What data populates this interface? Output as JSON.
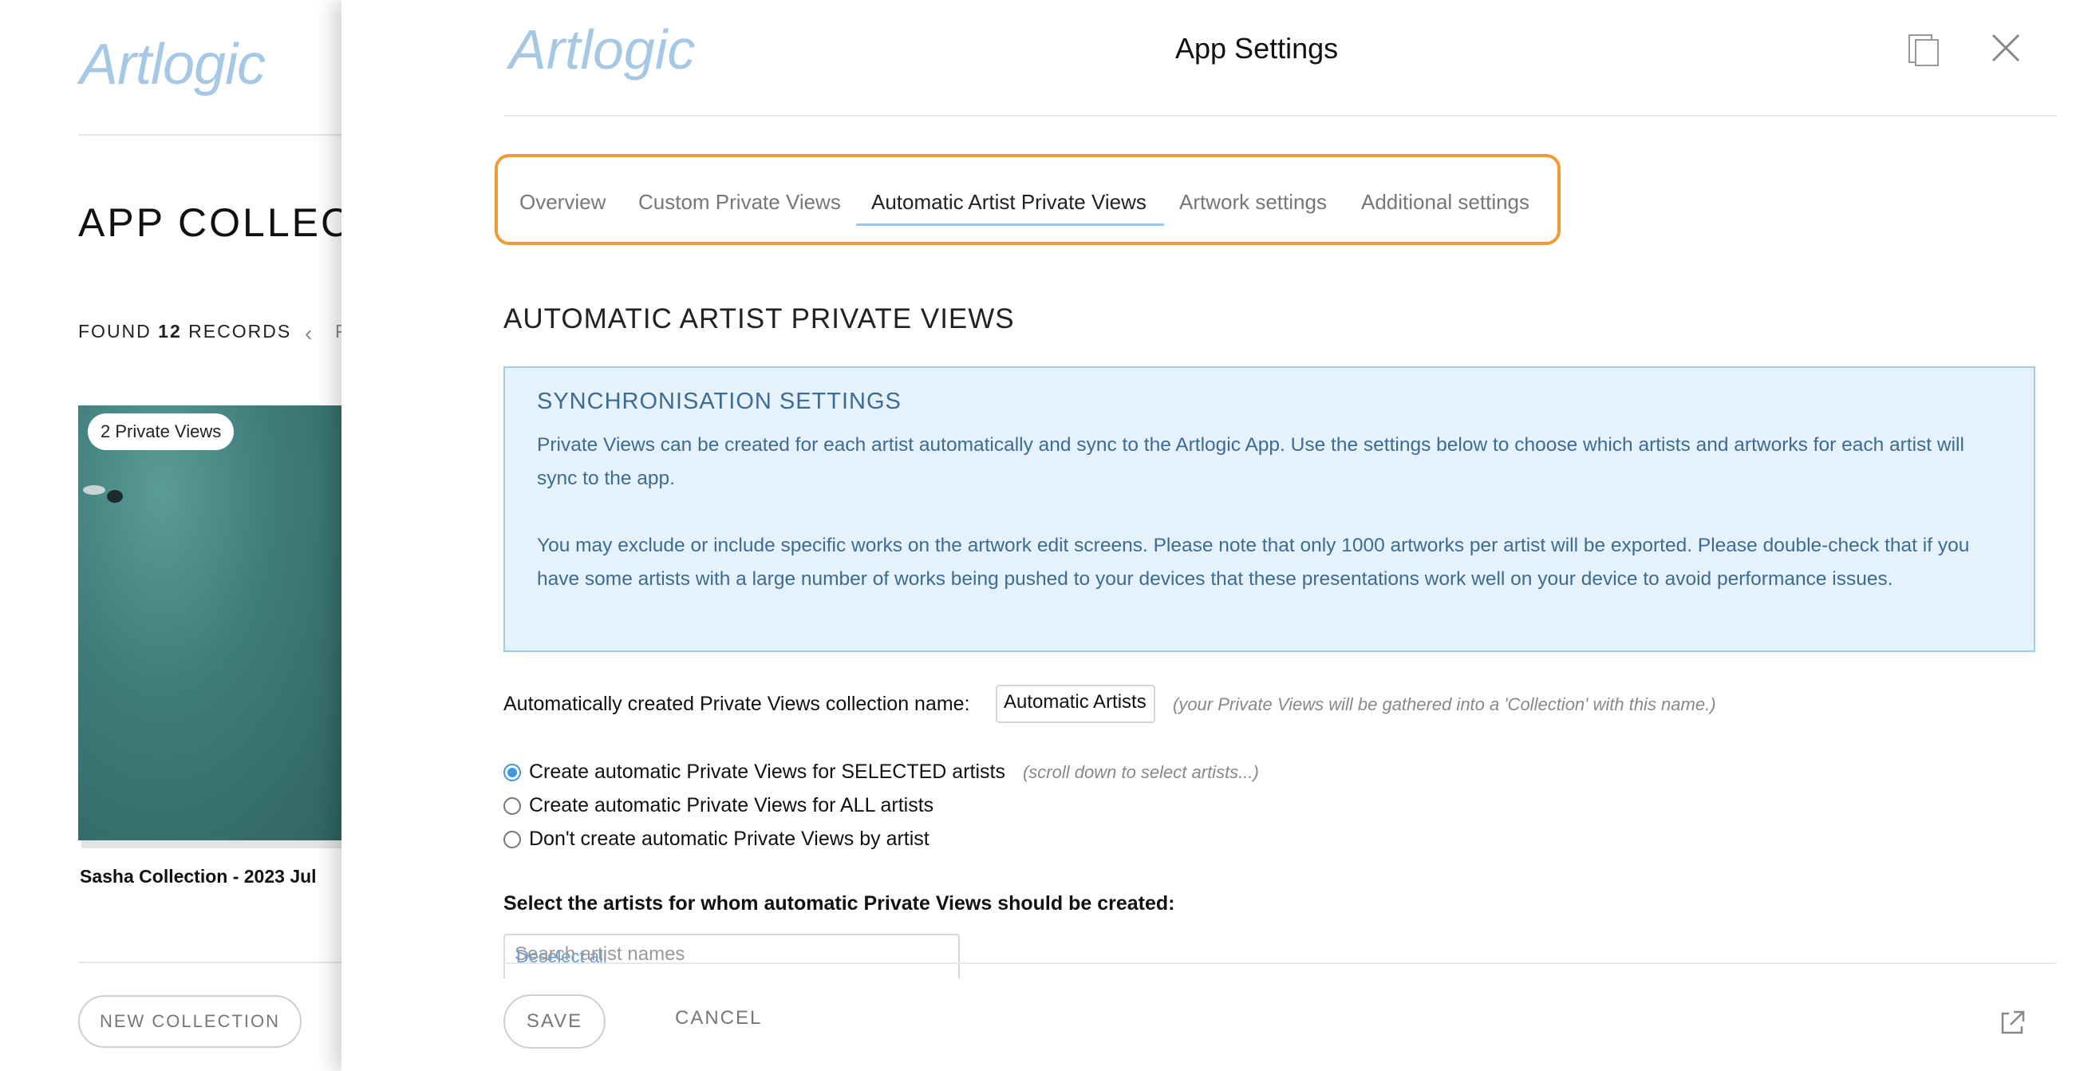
{
  "background": {
    "logo": "Artlogic",
    "title": "APP COLLECT",
    "found_prefix": "FOUND",
    "found_count": "12",
    "found_suffix": "RECORDS",
    "pager_text": "P",
    "card": {
      "badge": "2 Private Views",
      "title": "Sasha Collection - 2023 Jul"
    },
    "new_collection_label": "NEW COLLECTION"
  },
  "panel": {
    "logo": "Artlogic",
    "title": "App Settings",
    "icons": {
      "copy": "copy-icon",
      "close": "close-icon",
      "external": "external-link-icon"
    },
    "tabs": [
      {
        "label": "Overview",
        "active": false
      },
      {
        "label": "Custom Private Views",
        "active": false
      },
      {
        "label": "Automatic Artist Private Views",
        "active": true
      },
      {
        "label": "Artwork settings",
        "active": false
      },
      {
        "label": "Additional settings",
        "active": false
      }
    ],
    "section_title": "AUTOMATIC ARTIST PRIVATE VIEWS",
    "sync": {
      "title": "SYNCHRONISATION SETTINGS",
      "paragraph1": "Private Views can be created for each artist automatically and sync to the Artlogic App. Use the settings below to choose which artists and artworks for each artist will sync to the app.",
      "paragraph2": "You may exclude or include specific works on the artwork edit screens. Please note that only 1000 artworks per artist will be exported. Please double-check that if you have some artists with a large number of works being pushed to your devices that these presentations work well on your device to avoid performance issues."
    },
    "collection_name": {
      "label": "Automatically created Private Views collection name:",
      "value": "Automatic Artists",
      "hint": "(your Private Views will be gathered into a 'Collection' with this name.)"
    },
    "radios": [
      {
        "label": "Create automatic Private Views for SELECTED artists",
        "hint": "(scroll down to select artists...)",
        "checked": true
      },
      {
        "label": "Create automatic Private Views for ALL artists",
        "hint": "",
        "checked": false
      },
      {
        "label": "Don't create automatic Private Views by artist",
        "hint": "",
        "checked": false
      }
    ],
    "select_artists_label": "Select the artists for whom automatic Private Views should be created:",
    "search": {
      "placeholder": "Search artist names",
      "ghost_text": "Deselect all"
    },
    "footer": {
      "save_label": "SAVE",
      "cancel_label": "CANCEL"
    }
  }
}
